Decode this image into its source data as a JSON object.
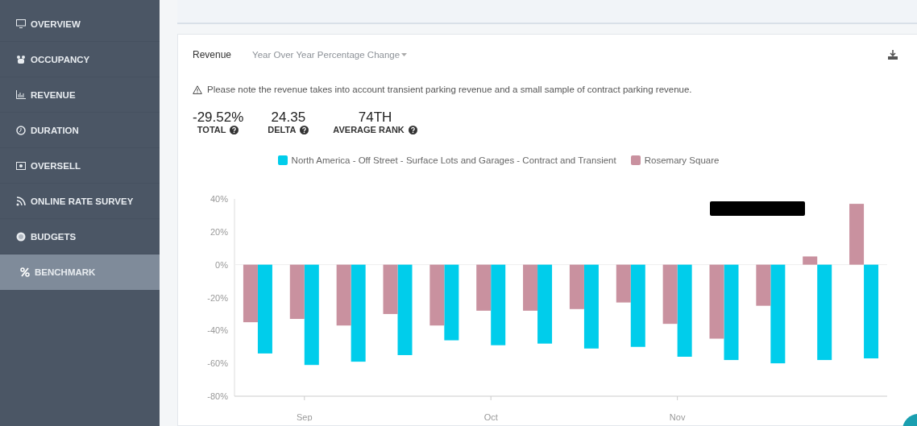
{
  "sidebar": {
    "items": [
      {
        "label": "OVERVIEW",
        "selected": false
      },
      {
        "label": "OCCUPANCY",
        "selected": false
      },
      {
        "label": "REVENUE",
        "selected": false
      },
      {
        "label": "DURATION",
        "selected": false
      },
      {
        "label": "OVERSELL",
        "selected": false
      },
      {
        "label": "ONLINE RATE SURVEY",
        "selected": false
      },
      {
        "label": "BUDGETS",
        "selected": false
      },
      {
        "label": "BENCHMARK",
        "selected": true
      }
    ]
  },
  "card": {
    "title": "Revenue",
    "dropdown": "Year Over Year Percentage Change",
    "notice": "Please note the revenue takes into account transient parking revenue and a small sample of contract parking revenue.",
    "stats": [
      {
        "value": "-29.52%",
        "label": "TOTAL"
      },
      {
        "value": "24.35",
        "label": "DELTA"
      },
      {
        "value": "74TH",
        "label": "AVERAGE RANK"
      }
    ],
    "chart_data": {
      "type": "bar",
      "categories": [
        null,
        "Sep",
        null,
        null,
        null,
        "Oct",
        null,
        null,
        null,
        "Nov",
        null,
        null,
        null,
        null
      ],
      "ylim": [
        -80,
        40
      ],
      "yticks": [
        {
          "value": 40,
          "label": "40%"
        },
        {
          "value": 20,
          "label": "20%"
        },
        {
          "value": 0,
          "label": "0%"
        },
        {
          "value": -20,
          "label": "-20%"
        },
        {
          "value": -40,
          "label": "-40%"
        },
        {
          "value": -60,
          "label": "-60%"
        },
        {
          "value": -80,
          "label": "-80%"
        }
      ],
      "series": [
        {
          "name": "North America - Off Street - Surface Lots and Garages - Contract and Transient",
          "color": "#00cdeb",
          "values": [
            -54,
            -61,
            -59,
            -55,
            -46,
            -49,
            -48,
            -51,
            -50,
            -56,
            -58,
            -60,
            -58,
            -57
          ]
        },
        {
          "name": "Rosemary Square",
          "color": "#c9919f",
          "values": [
            -35,
            -33,
            -37,
            -30,
            -37,
            -28,
            -28,
            -27,
            -23,
            -36,
            -45,
            -25,
            5,
            37
          ]
        }
      ]
    }
  }
}
